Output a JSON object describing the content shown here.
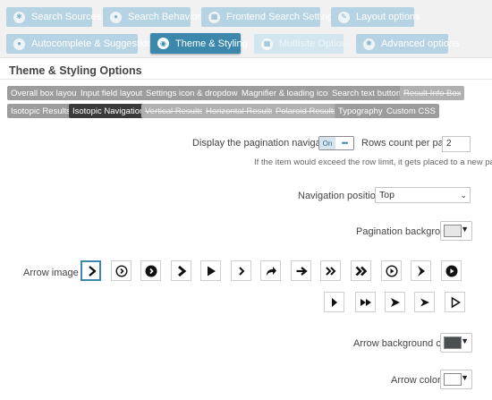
{
  "nav": {
    "tabs": [
      {
        "label": "Search Sources",
        "icon": "gear-icon",
        "state": "normal"
      },
      {
        "label": "Search Behavior",
        "icon": "pin-icon",
        "state": "normal"
      },
      {
        "label": "Frontend Search Settings",
        "icon": "grid-icon",
        "state": "normal"
      },
      {
        "label": "Layout options",
        "icon": "pencil-icon",
        "state": "normal"
      },
      {
        "label": "Autocomplete & Suggestions",
        "icon": "pin-icon",
        "state": "normal"
      },
      {
        "label": "Theme & Styling",
        "icon": "eye-icon",
        "state": "active"
      },
      {
        "label": "Multisite Options",
        "icon": "grid-icon",
        "state": "disabled"
      },
      {
        "label": "Advanced options",
        "icon": "gears-icon",
        "state": "normal"
      }
    ]
  },
  "panel": {
    "title": "Theme & Styling Options",
    "subtabs": [
      {
        "label": "Overall box layout",
        "state": "normal"
      },
      {
        "label": "Input field layout",
        "state": "normal"
      },
      {
        "label": "Settings icon & dropdown",
        "state": "normal"
      },
      {
        "label": "Magnifier & loading icon",
        "state": "normal"
      },
      {
        "label": "Search text button",
        "state": "normal"
      },
      {
        "label": "Result Info Box",
        "state": "strike"
      },
      {
        "label": "Isotopic Results",
        "state": "normal"
      },
      {
        "label": "Isotopic Navigation",
        "state": "active"
      },
      {
        "label": "Vertical Results",
        "state": "strike"
      },
      {
        "label": "Horizontal Results",
        "state": "strike"
      },
      {
        "label": "Polaroid Results",
        "state": "strike"
      },
      {
        "label": "Typography",
        "state": "normal"
      },
      {
        "label": "Custom CSS",
        "state": "normal"
      }
    ]
  },
  "pagination": {
    "display_label": "Display the pagination navigation?",
    "toggle_on_label": "On",
    "toggle_knob": "•••",
    "rows_label": "Rows count per page",
    "rows_value": "2",
    "note": "If the item would exceed the row limit, it gets placed to a new page.",
    "position_label": "Navigation position",
    "position_value": "Top",
    "background_label": "Pagination background",
    "background_color": "#e6e6e6"
  },
  "arrows": {
    "label": "Arrow image",
    "selected_index": 0,
    "items": [
      "chevron-right-icon",
      "circle-chevron-outline-icon",
      "circle-chevron-filled-icon",
      "bold-chevron-right-icon",
      "play-triangle-icon",
      "small-chevron-right-icon",
      "share-arrow-icon",
      "arrow-right-icon",
      "double-chevron-icon",
      "double-chevron-bold-icon",
      "circle-play-outline-icon",
      "bold-arrowhead-icon",
      "circle-play-filled-icon",
      "play-thin-icon",
      "fast-forward-icon",
      "arrowhead-right-icon",
      "dart-right-icon",
      "outline-triangle-right-icon"
    ],
    "bg_label": "Arrow background color",
    "bg_color": "#4a4f54",
    "color_label": "Arrow color",
    "color": "#ffffff"
  },
  "colors": {
    "accent": "#3b88ac",
    "tab_light": "#b6d3e3",
    "subtab_gray": "#9c9c9c"
  }
}
